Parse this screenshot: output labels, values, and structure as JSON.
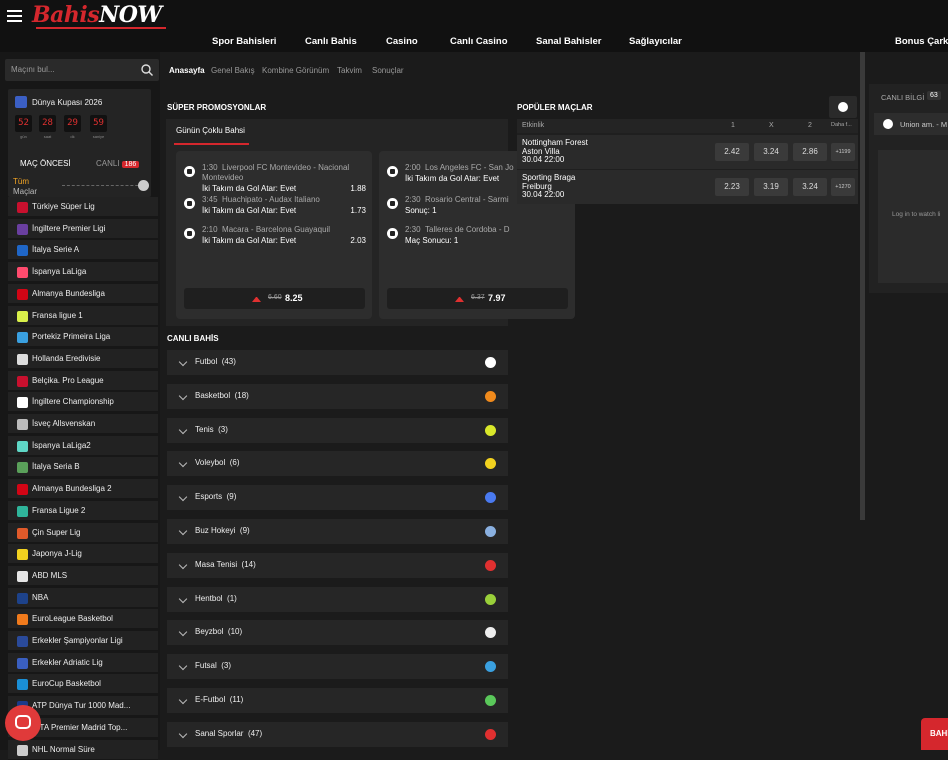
{
  "header": {
    "logo_text": "BahisNOW",
    "nav": [
      "Spor Bahisleri",
      "Canlı Bahis",
      "Casino",
      "Canlı Casino",
      "Sanal Bahisler",
      "Sağlayıcılar"
    ],
    "bonus": "Bonus Çarkı"
  },
  "sidebar": {
    "search_placeholder": "Maçını bul...",
    "worldcup": {
      "title": "Dünya Kupası 2026",
      "countdown": [
        "52",
        "28",
        "29",
        "59"
      ],
      "labels": [
        "gün",
        "saat",
        "dk",
        "saniye"
      ]
    },
    "tabs": {
      "prematch": "MAÇ ÖNCESİ",
      "live": "CANLI",
      "live_count": "186"
    },
    "all_matches": [
      "Tüm",
      "Maçlar"
    ],
    "leagues": [
      {
        "name": "Türkiye Süper Lig",
        "color": "#c8102e"
      },
      {
        "name": "İngiltere Premier Ligi",
        "color": "#6a3fa0"
      },
      {
        "name": "İtalya Serie A",
        "color": "#1f66c7"
      },
      {
        "name": "İspanya LaLiga",
        "color": "#ff4b6e"
      },
      {
        "name": "Almanya Bundesliga",
        "color": "#d20515"
      },
      {
        "name": "Fransa ligue 1",
        "color": "#d9f04a"
      },
      {
        "name": "Portekiz Primeira Liga",
        "color": "#3aa0e0"
      },
      {
        "name": "Hollanda Eredivisie",
        "color": "#dddddd"
      },
      {
        "name": "Belçika. Pro League",
        "color": "#c8102e"
      },
      {
        "name": "İngiltere Championship",
        "color": "#ffffff"
      },
      {
        "name": "İsveç Allsvenskan",
        "color": "#bbbbbb"
      },
      {
        "name": "İspanya LaLiga2",
        "color": "#5fd7c6"
      },
      {
        "name": "İtalya Seria B",
        "color": "#5aa05a"
      },
      {
        "name": "Almanya Bundesliga 2",
        "color": "#d20515"
      },
      {
        "name": "Fransa Ligue 2",
        "color": "#2fb59b"
      },
      {
        "name": "Çin Super Lig",
        "color": "#e05a2a"
      },
      {
        "name": "Japonya J-Lig",
        "color": "#f2d21f"
      },
      {
        "name": "ABD MLS",
        "color": "#e6e6e6"
      },
      {
        "name": "NBA",
        "color": "#1d428a"
      },
      {
        "name": "EuroLeague Basketbol",
        "color": "#f07a1c"
      },
      {
        "name": "Erkekler Şampiyonlar Ligi",
        "color": "#2a4a9a"
      },
      {
        "name": "Erkekler Adriatic Lig",
        "color": "#3a5fc0"
      },
      {
        "name": "EuroCup Basketbol",
        "color": "#1a8fd6"
      },
      {
        "name": "ATP Dünya Tur 1000 Mad...",
        "color": "#1a3a8a"
      },
      {
        "name": "WTA Premier Madrid Top...",
        "color": "#7a3fa0"
      },
      {
        "name": "NHL Normal Süre",
        "color": "#cccccc"
      }
    ]
  },
  "breadcrumbs": [
    "Anasayfa",
    "Genel Bakış",
    "Kombine Görünüm",
    "Takvim",
    "Sonuçlar"
  ],
  "promos": {
    "title": "SÜPER PROMOSYONLAR",
    "tab": "Günün Çoklu Bahsi",
    "cards": [
      {
        "selections": [
          {
            "time": "1:30",
            "match": "Liverpool FC Montevideo - Nacional Montevideo",
            "pick": "İki Takım da Gol Atar: Evet",
            "odd": "1.88"
          },
          {
            "time": "3:45",
            "match": "Huachipato - Audax Italiano",
            "pick": "İki Takım da Gol Atar: Evet",
            "odd": "1.73"
          },
          {
            "time": "2:10",
            "match": "Macara - Barcelona Guayaquil",
            "pick": "İki Takım da Gol Atar: Evet",
            "odd": "2.03"
          }
        ],
        "old_odd": "6.60",
        "new_odd": "8.25"
      },
      {
        "selections": [
          {
            "time": "2:00",
            "match": "Los Angeles FC - San Jo",
            "pick": "İki Takım da Gol Atar: Evet",
            "odd": ""
          },
          {
            "time": "2:30",
            "match": "Rosario Central - Sarmi",
            "pick": "Sonuç: 1",
            "odd": ""
          },
          {
            "time": "2:30",
            "match": "Talleres de Cordoba - D",
            "pick": "Maç Sonucu: 1",
            "odd": ""
          }
        ],
        "old_odd": "6.37",
        "new_odd": "7.97"
      }
    ]
  },
  "live": {
    "title": "CANLI BAHİS",
    "sports": [
      {
        "name": "Futbol",
        "count": "(43)",
        "color": "#ffffff"
      },
      {
        "name": "Basketbol",
        "count": "(18)",
        "color": "#f08a1c"
      },
      {
        "name": "Tenis",
        "count": "(3)",
        "color": "#d9e82a"
      },
      {
        "name": "Voleybol",
        "count": "(6)",
        "color": "#f2d21f"
      },
      {
        "name": "Esports",
        "count": "(9)",
        "color": "#4a7af0"
      },
      {
        "name": "Buz Hokeyi",
        "count": "(9)",
        "color": "#8ab0e0"
      },
      {
        "name": "Masa Tenisi",
        "count": "(14)",
        "color": "#e03030"
      },
      {
        "name": "Hentbol",
        "count": "(1)",
        "color": "#9ad03a"
      },
      {
        "name": "Beyzbol",
        "count": "(10)",
        "color": "#eeeeee"
      },
      {
        "name": "Futsal",
        "count": "(3)",
        "color": "#3aa0e0"
      },
      {
        "name": "E-Futbol",
        "count": "(11)",
        "color": "#5ac85a"
      },
      {
        "name": "Sanal Sporlar",
        "count": "(47)",
        "color": "#e03030"
      }
    ]
  },
  "popular": {
    "title": "POPÜLER MAÇLAR",
    "headers": [
      "Etkinlik",
      "1",
      "X",
      "2",
      "Daha f..."
    ],
    "matches": [
      {
        "home": "Nottingham Forest",
        "away": "Aston Villa",
        "date": "30.04 22:00",
        "odds": [
          "2.42",
          "3.24",
          "2.86"
        ],
        "more": "+1199"
      },
      {
        "home": "Sporting Braga",
        "away": "Freiburg",
        "date": "30.04 22:00",
        "odds": [
          "2.23",
          "3.19",
          "3.24"
        ],
        "more": "+1270"
      }
    ]
  },
  "right": {
    "tab": "CANLI BİLGİ",
    "count": "63",
    "match": "Union am. - M",
    "login_msg": "Log in to watch li"
  },
  "bahis_btn": "BAHİS"
}
